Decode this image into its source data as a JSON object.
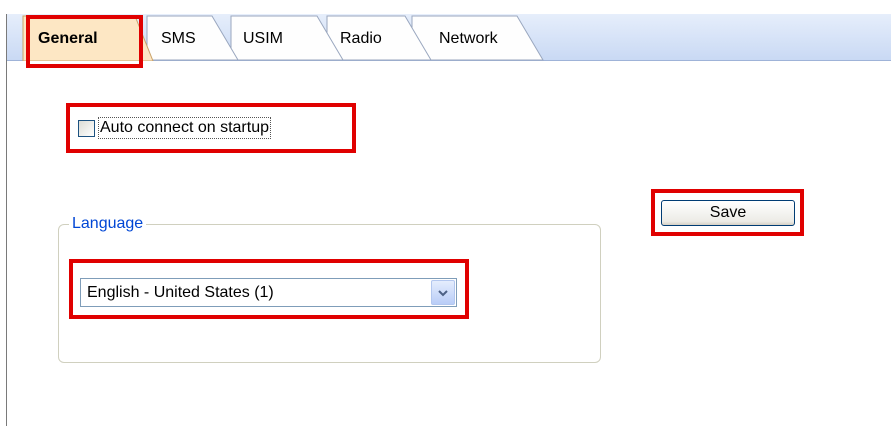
{
  "tabs": [
    {
      "label": "General",
      "active": true
    },
    {
      "label": "SMS",
      "active": false
    },
    {
      "label": "USIM",
      "active": false
    },
    {
      "label": "Radio",
      "active": false
    },
    {
      "label": "Network",
      "active": false
    }
  ],
  "general": {
    "auto_connect": {
      "label": "Auto connect on startup",
      "checked": false
    },
    "language_group": {
      "legend": "Language",
      "selected": "English - United States (1)"
    },
    "save_label": "Save"
  },
  "colors": {
    "highlight": "#e00000",
    "active_tab": "#fde7c4",
    "legend_text": "#0046d5"
  },
  "icons": {
    "combo_arrow": "chevron-down-icon"
  }
}
